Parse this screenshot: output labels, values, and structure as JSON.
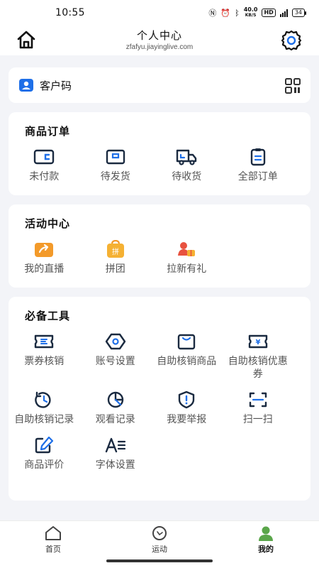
{
  "status": {
    "time": "10:55",
    "speed_top": "40.0",
    "speed_unit": "KB/S",
    "hd": "HD",
    "battery": "34"
  },
  "header": {
    "title": "个人中心",
    "subtitle": "zfafyu.jiayinglive.com"
  },
  "customer_code": {
    "label": "客户码"
  },
  "orders": {
    "title": "商品订单",
    "items": [
      {
        "label": "未付款",
        "icon": "wallet-icon"
      },
      {
        "label": "待发货",
        "icon": "box-icon"
      },
      {
        "label": "待收货",
        "icon": "truck-icon"
      },
      {
        "label": "全部订单",
        "icon": "clipboard-icon"
      }
    ]
  },
  "activities": {
    "title": "活动中心",
    "items": [
      {
        "label": "我的直播",
        "icon": "live-icon"
      },
      {
        "label": "拼团",
        "icon": "group-buy-icon"
      },
      {
        "label": "拉新有礼",
        "icon": "invite-icon"
      }
    ]
  },
  "tools": {
    "title": "必备工具",
    "items": [
      {
        "label": "票券核销",
        "icon": "ticket-icon"
      },
      {
        "label": "账号设置",
        "icon": "account-settings-icon"
      },
      {
        "label": "自助核销商品",
        "icon": "bag-icon"
      },
      {
        "label": "自助核销优惠券",
        "icon": "coupon-icon"
      },
      {
        "label": "自助核销记录",
        "icon": "history-icon"
      },
      {
        "label": "观看记录",
        "icon": "pie-chart-icon"
      },
      {
        "label": "我要举报",
        "icon": "report-icon"
      },
      {
        "label": "扫一扫",
        "icon": "scan-icon"
      },
      {
        "label": "商品评价",
        "icon": "edit-icon"
      },
      {
        "label": "字体设置",
        "icon": "font-icon"
      }
    ]
  },
  "tabbar": {
    "items": [
      {
        "label": "首页",
        "icon": "home-icon"
      },
      {
        "label": "运动",
        "icon": "sport-icon"
      },
      {
        "label": "我的",
        "icon": "profile-icon"
      }
    ],
    "active": "我的"
  },
  "colors": {
    "accent": "#1e6fe8",
    "icon": "#1a2a40",
    "active_tab": "#5aa64a",
    "orange": "#f39a2a"
  }
}
